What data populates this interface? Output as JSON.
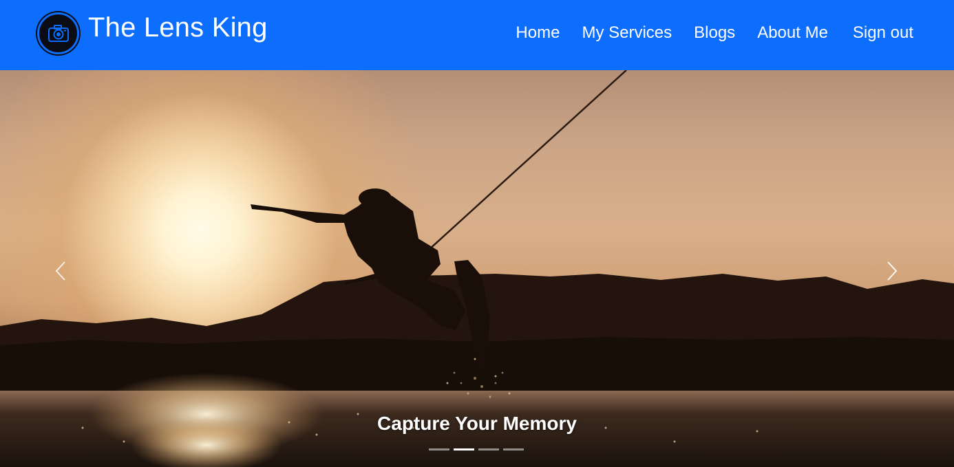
{
  "brand": {
    "title": "The Lens King",
    "logo_icon": "camera-icon"
  },
  "nav": {
    "items": [
      {
        "label": "Home"
      },
      {
        "label": "My Services"
      },
      {
        "label": "Blogs"
      },
      {
        "label": "About Me"
      },
      {
        "label": "Sign out"
      }
    ]
  },
  "carousel": {
    "caption": "Capture Your Memory",
    "slide_count": 4,
    "active_index": 1,
    "prev_icon": "chevron-left-icon",
    "next_icon": "chevron-right-icon"
  },
  "colors": {
    "navbar": "#0d6efd",
    "text": "#ffffff"
  }
}
